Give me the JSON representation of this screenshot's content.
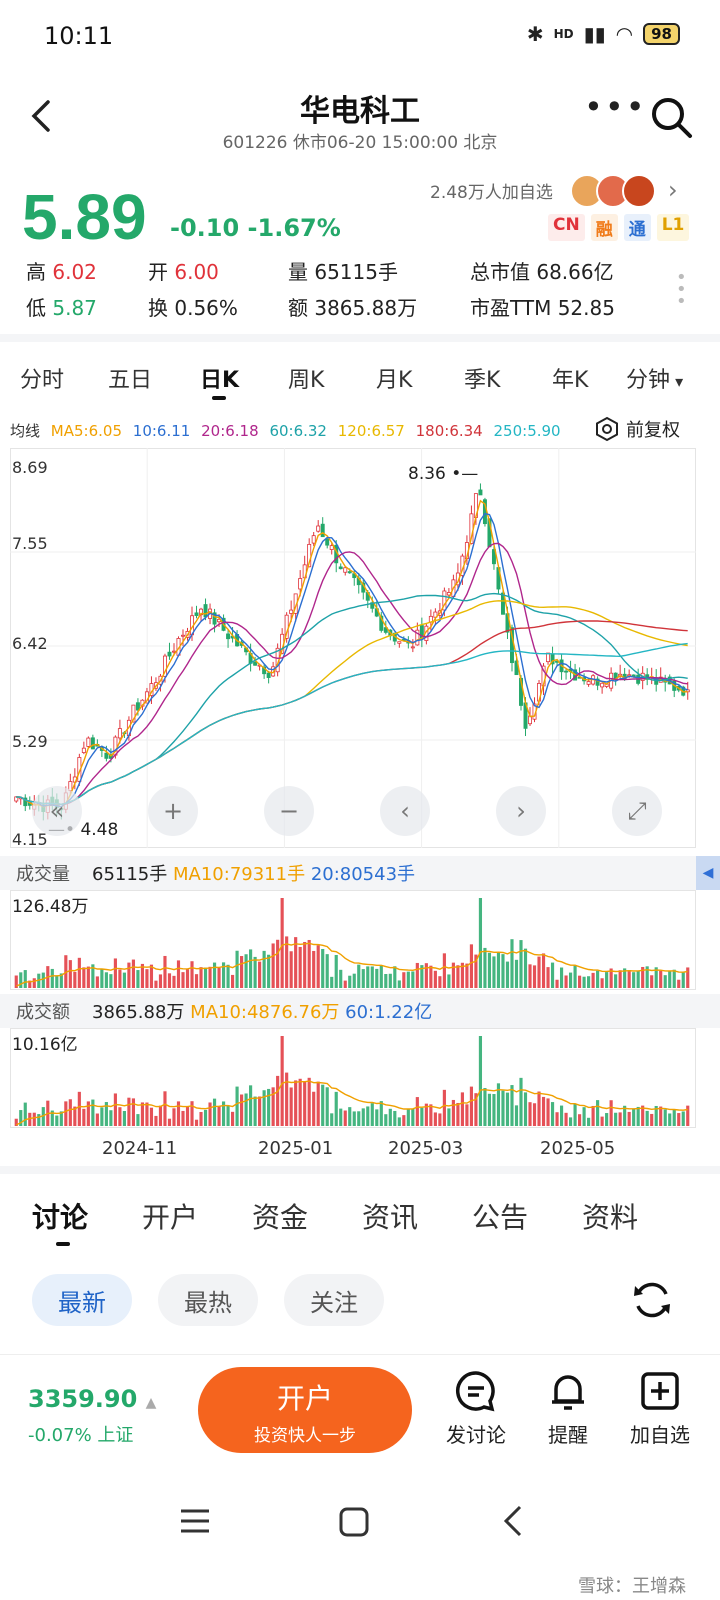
{
  "status": {
    "time": "10:11",
    "net": "HD",
    "battery": "98"
  },
  "header": {
    "title": "华电科工",
    "subtitle": "601226 休市06-20 15:00:00 北京"
  },
  "quote": {
    "price": "5.89",
    "change": "-0.10",
    "change_pct": "-1.67%",
    "followers": "2.48万人加自选",
    "badges": [
      "CN",
      "融",
      "通",
      "L1"
    ],
    "stats": {
      "high_label": "高",
      "high": "6.02",
      "low_label": "低",
      "low": "5.87",
      "open_label": "开",
      "open": "6.00",
      "turnover_label": "换",
      "turnover": "0.56%",
      "vol_label": "量",
      "vol": "65115手",
      "amt_label": "额",
      "amt": "3865.88万",
      "mcap_label": "总市值",
      "mcap": "68.66亿",
      "pe_label": "市盈TTM",
      "pe": "52.85"
    }
  },
  "chart_tabs": [
    "分时",
    "五日",
    "日K",
    "周K",
    "月K",
    "季K",
    "年K",
    "分钟"
  ],
  "active_chart_tab": 2,
  "ma": {
    "label": "均线",
    "items": [
      "MA5:6.05",
      "10:6.11",
      "20:6.18",
      "60:6.32",
      "120:6.57",
      "180:6.34",
      "250:5.90"
    ],
    "colors": [
      "#f0a000",
      "#2c6fd1",
      "#b0268c",
      "#1ea2a8",
      "#e8b800",
      "#d0343a",
      "#24b6c4"
    ]
  },
  "adjust_label": "前复权",
  "price_axis": [
    "8.69",
    "7.55",
    "6.42",
    "5.29",
    "4.15"
  ],
  "annotations": {
    "high": "8.36",
    "low": "4.48"
  },
  "volume": {
    "label": "成交量",
    "value": "65115手",
    "ma10": "MA10:79311手",
    "ma20": "20:80543手",
    "max": "126.48万"
  },
  "amount": {
    "label": "成交额",
    "value": "3865.88万",
    "ma10": "MA10:4876.76万",
    "ma60": "60:1.22亿",
    "max": "10.16亿"
  },
  "x_labels": [
    "2024-11",
    "2025-01",
    "2025-03",
    "2025-05"
  ],
  "chart_data": {
    "type": "candlestick",
    "x_range": [
      "2024-09",
      "2025-06-20"
    ],
    "ylim": [
      4.15,
      8.69
    ],
    "max_label": 8.36,
    "min_label": 4.48,
    "last_close": 5.89,
    "volume_max": "126.48万",
    "amount_max": "10.16亿",
    "close_trend": [
      4.6,
      4.5,
      4.48,
      5.3,
      5.1,
      5.6,
      6.0,
      6.5,
      6.9,
      6.6,
      6.3,
      6.1,
      7.0,
      7.9,
      7.4,
      7.0,
      6.6,
      6.4,
      6.8,
      7.2,
      8.36,
      6.8,
      5.5,
      6.3,
      6.1,
      6.0,
      6.1,
      6.05,
      5.95,
      5.89
    ]
  },
  "discuss_tabs": [
    "讨论",
    "开户",
    "资金",
    "资讯",
    "公告",
    "资料"
  ],
  "filters": [
    "最新",
    "最热",
    "关注"
  ],
  "bottom": {
    "index_value": "3359.90",
    "index_change": "-0.07% 上证",
    "open_label": "开户",
    "open_sub": "投资快人一步",
    "actions": [
      "发讨论",
      "提醒",
      "加自选"
    ]
  },
  "watermark": "雪球：王增森"
}
